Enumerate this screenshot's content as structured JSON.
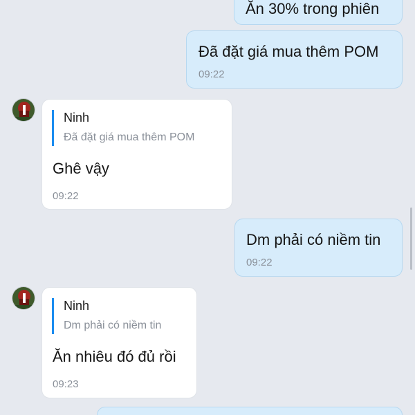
{
  "messages": {
    "m1": {
      "text": "Ăn 30% trong phiên"
    },
    "m2": {
      "text": "Đã đặt giá mua thêm POM",
      "time": "09:22"
    },
    "m3": {
      "reply_name": "Ninh",
      "reply_text": "Đã đặt giá mua thêm POM",
      "text": "Ghê vậy",
      "time": "09:22"
    },
    "m4": {
      "text": "Dm phải có niềm tin",
      "time": "09:22"
    },
    "m5": {
      "reply_name": "Ninh",
      "reply_text": "Dm phải có niềm tin",
      "text": "Ăn nhiêu đó đủ rồi",
      "time": "09:23"
    }
  },
  "colors": {
    "background": "#e6e9ef",
    "outgoing_bubble": "#d7ecfb",
    "incoming_bubble": "#ffffff",
    "quote_bar": "#1a8cf0",
    "timestamp": "#8a9099"
  },
  "icons": {
    "avatar": "contact-avatar-icon"
  }
}
